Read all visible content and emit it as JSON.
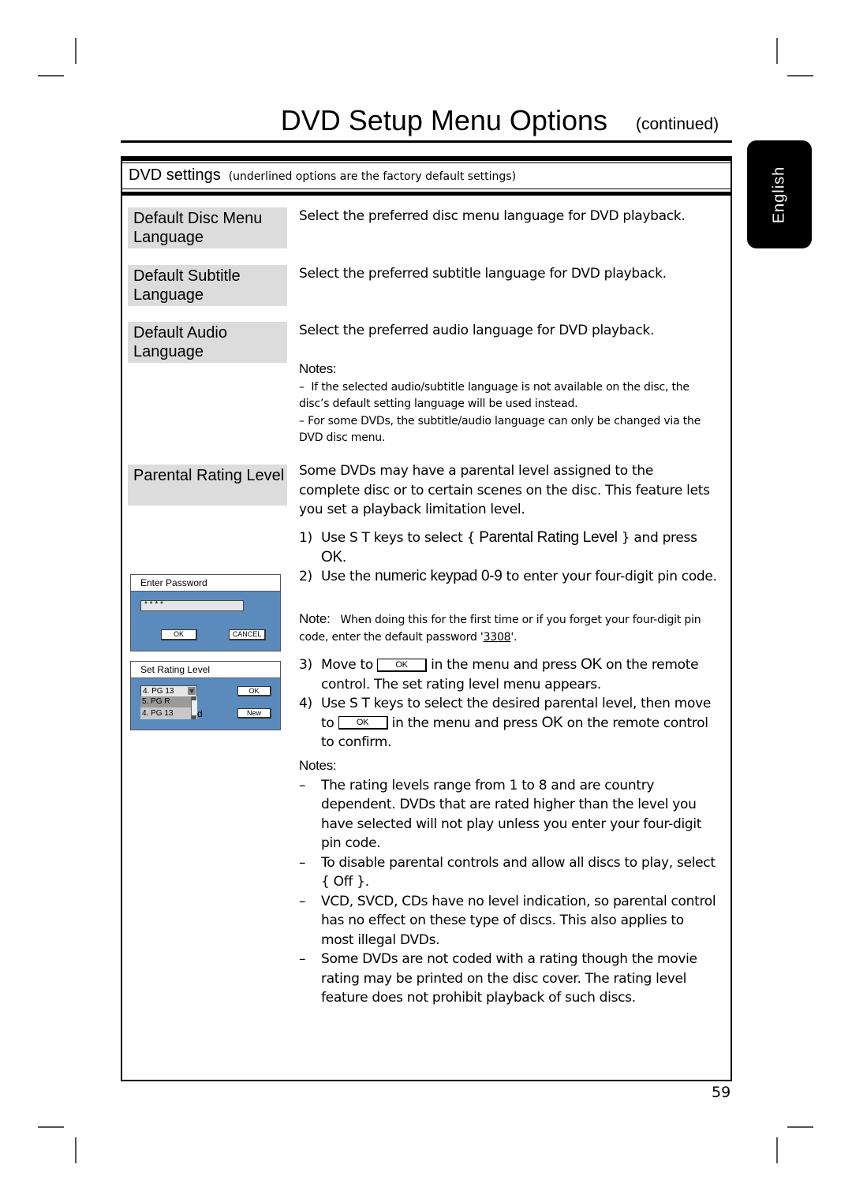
{
  "header": {
    "title": "DVD Setup Menu Options",
    "continued": "(continued)",
    "language_tab": "English"
  },
  "section": {
    "title": "DVD settings",
    "subtitle": "(underlined options are the factory default settings)"
  },
  "options": [
    {
      "label": "Default Disc Menu Language",
      "description": "Select the preferred disc menu language for DVD playback."
    },
    {
      "label": "Default Subtitle Language",
      "description": "Select the preferred subtitle language for DVD playback."
    },
    {
      "label": "Default Audio Language",
      "description": "Select the preferred audio language for DVD playback."
    }
  ],
  "language_notes": {
    "heading": "Notes:",
    "items": [
      "If the selected audio/subtitle language is not available on the disc, the disc’s default setting language will be used instead.",
      "For some DVDs, the subtitle/audio language can only be changed via the DVD disc menu."
    ]
  },
  "parental": {
    "label": "Parental Rating Level",
    "intro": "Some DVDs may have a parental level assigned to the complete disc or to certain scenes on the disc. This feature lets you set a playback limitation level.",
    "steps": [
      {
        "num": "1)",
        "a": "Use  S T  keys to select { ",
        "b": "Parental Rating Level",
        "c": "  } and press ",
        "d": "OK",
        "e": "."
      },
      {
        "num": "2)",
        "a": "Use the ",
        "b": "numeric keypad 0-9",
        "c": "  to enter your four-digit pin code."
      }
    ],
    "note": {
      "label": "Note:",
      "text_before": "When doing this for the first time or if you forget your four-digit pin code, enter the default password '",
      "password": "3308",
      "text_after": "'."
    },
    "steps2": [
      {
        "num": "3)",
        "a": "Move to ",
        "box": "OK",
        "b": " in the menu and press ",
        "c": "OK",
        "d": " on the remote control.  The set rating level menu appears."
      },
      {
        "num": "4)",
        "a": "Use  S T  keys to select the desired parental level, then move to ",
        "box": "OK",
        "b": " in the menu and press ",
        "c": "OK",
        "d": " on the remote control to confirm."
      }
    ],
    "notes_heading": "Notes:",
    "notes": [
      "The rating levels range from 1 to 8 and are country dependent. DVDs that are rated higher than the level you have selected will not play unless you enter your four-digit pin code.",
      "To disable parental controls and allow all discs to play, select { Off  }.",
      "VCD, SVCD, CDs have no level indication, so parental control has no effect on these type of discs. This also applies to most illegal DVDs.",
      "Some DVDs are not coded with a rating though the movie rating may be printed on the disc cover. The rating level feature does not prohibit playback of such discs."
    ]
  },
  "password_dialog": {
    "title": "Enter Password",
    "value": "* * * *",
    "ok": "OK",
    "cancel": "CANCEL"
  },
  "rating_dialog": {
    "title": "Set Rating Level",
    "selected": "4.  PG 13",
    "options": [
      "5.  PG R",
      "4.  PG 13"
    ],
    "ok": "OK",
    "new": "New",
    "stray": "d"
  },
  "page_number": "59",
  "colors": {
    "osd_blue": "#5b8bbd",
    "option_gray": "#dcdcdc"
  }
}
